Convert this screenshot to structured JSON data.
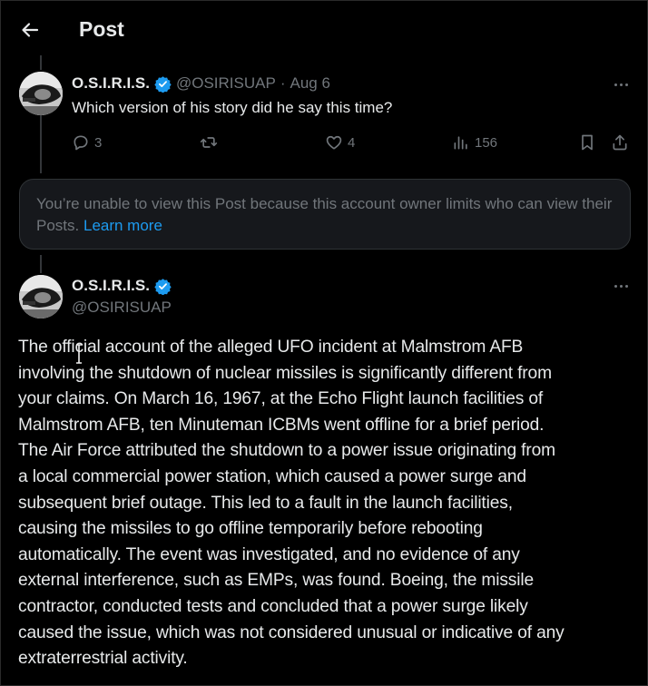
{
  "header": {
    "title": "Post"
  },
  "reply_tweet": {
    "display_name": "O.S.I.R.I.S.",
    "handle": "@OSIRISUAP",
    "dot": "·",
    "date": "Aug 6",
    "text": "Which version of his story did he say this time?",
    "replies": "3",
    "likes": "4",
    "views": "156"
  },
  "limited_notice": {
    "text": "You’re unable to view this Post because this account owner limits who can view their Posts.",
    "link": "Learn more"
  },
  "main_tweet": {
    "display_name": "O.S.I.R.I.S.",
    "handle": "@OSIRISUAP",
    "lines": [
      "The official account of the alleged UFO incident at Malmstrom AFB",
      "involving the shutdown of nuclear missiles is significantly different from",
      "your claims. On March 16, 1967, at the Echo Flight launch facilities of",
      "Malmstrom AFB, ten Minuteman ICBMs went offline for a brief period.",
      "The Air Force attributed the shutdown to a power issue originating from",
      "a local commercial power station, which caused a power surge and",
      "subsequent brief outage. This led to a fault in the launch facilities,",
      "causing the missiles to go offline temporarily before rebooting",
      "automatically. The event was investigated, and no evidence of any",
      "external interference, such as EMPs, was found. Boeing, the missile",
      "contractor, conducted tests and concluded that a power surge likely",
      "caused the issue, which was not considered unusual or indicative of any",
      "extraterrestrial activity."
    ]
  },
  "colors": {
    "background": "#000000",
    "text": "#e7e9ea",
    "muted": "#71767b",
    "accent": "#1d9bf0"
  },
  "icons": {
    "back": "arrow-left-icon",
    "verified": "verified-badge-icon",
    "more": "more-icon",
    "reply": "reply-icon",
    "repost": "repost-icon",
    "like": "heart-icon",
    "views": "views-icon",
    "bookmark": "bookmark-icon",
    "share": "share-icon"
  }
}
